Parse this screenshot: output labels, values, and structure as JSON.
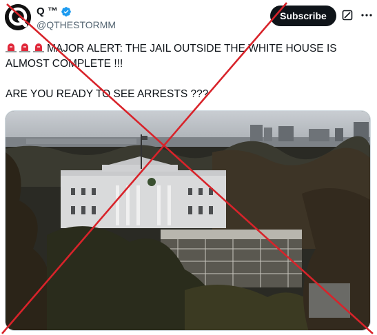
{
  "tweet": {
    "display_name": "Q ™",
    "handle": "@QTHESTORMM",
    "subscribe_label": "Subscribe",
    "text_line1": "MAJOR ALERT: THE JAIL OUTSIDE THE WHITE HOUSE IS",
    "text_line2": "ALMOST COMPLETE !!!",
    "text_line3": "ARE YOU READY TO SEE ARRESTS ???"
  },
  "icons": {
    "avatar": "q-logo-avatar",
    "verified": "verified-badge-icon",
    "grok": "grok-icon",
    "more": "more-options-icon",
    "siren": "police-light-emoji"
  },
  "colors": {
    "verified": "#1d9bf0",
    "cross": "#d8232a",
    "button_bg": "#0f1419"
  }
}
